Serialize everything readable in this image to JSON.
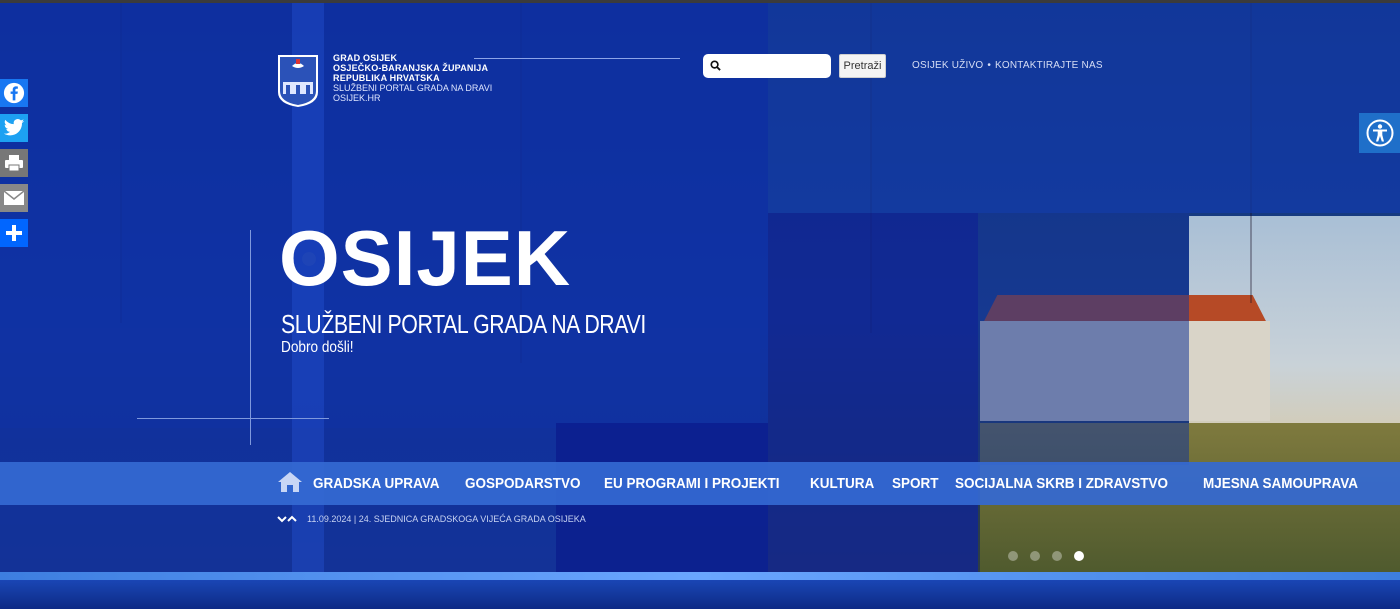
{
  "header": {
    "org_line1": "GRAD OSIJEK",
    "org_line2": "OSJEČKO-BARANJSKA ŽUPANIJA",
    "org_line3": "REPUBLIKA HRVATSKA",
    "org_line4": "SLUŽBENI PORTAL GRADA NA DRAVI",
    "org_line5": "OSIJEK.HR",
    "search_placeholder": "",
    "search_button": "Pretraži",
    "links": [
      "OSIJEK UŽIVO",
      "KONTAKTIRAJTE NAS"
    ],
    "link_separator": "•"
  },
  "hero": {
    "title": "OSIJEK",
    "subtitle": "SLUŽBENI PORTAL GRADA NA DRAVI",
    "welcome": "Dobro došli!"
  },
  "nav": {
    "items": [
      "GRADSKA UPRAVA",
      "GOSPODARSTVO",
      "EU PROGRAMI I PROJEKTI",
      "KULTURA",
      "SPORT",
      "SOCIJALNA SKRB I ZDRAVSTVO",
      "MJESNA SAMOUPRAVA"
    ]
  },
  "news": {
    "ticker": "11.09.2024 | 24. SJEDNICA GRADSKOGA VIJEĆA GRADA OSIJEKA"
  },
  "social": [
    "facebook-icon",
    "twitter-icon",
    "print-icon",
    "email-icon",
    "share-icon"
  ],
  "slider": {
    "count": 4,
    "active": 4
  },
  "colors": {
    "primary": "#0d30aa",
    "nav": "#3469d2",
    "accent": "#1f6fc9"
  }
}
